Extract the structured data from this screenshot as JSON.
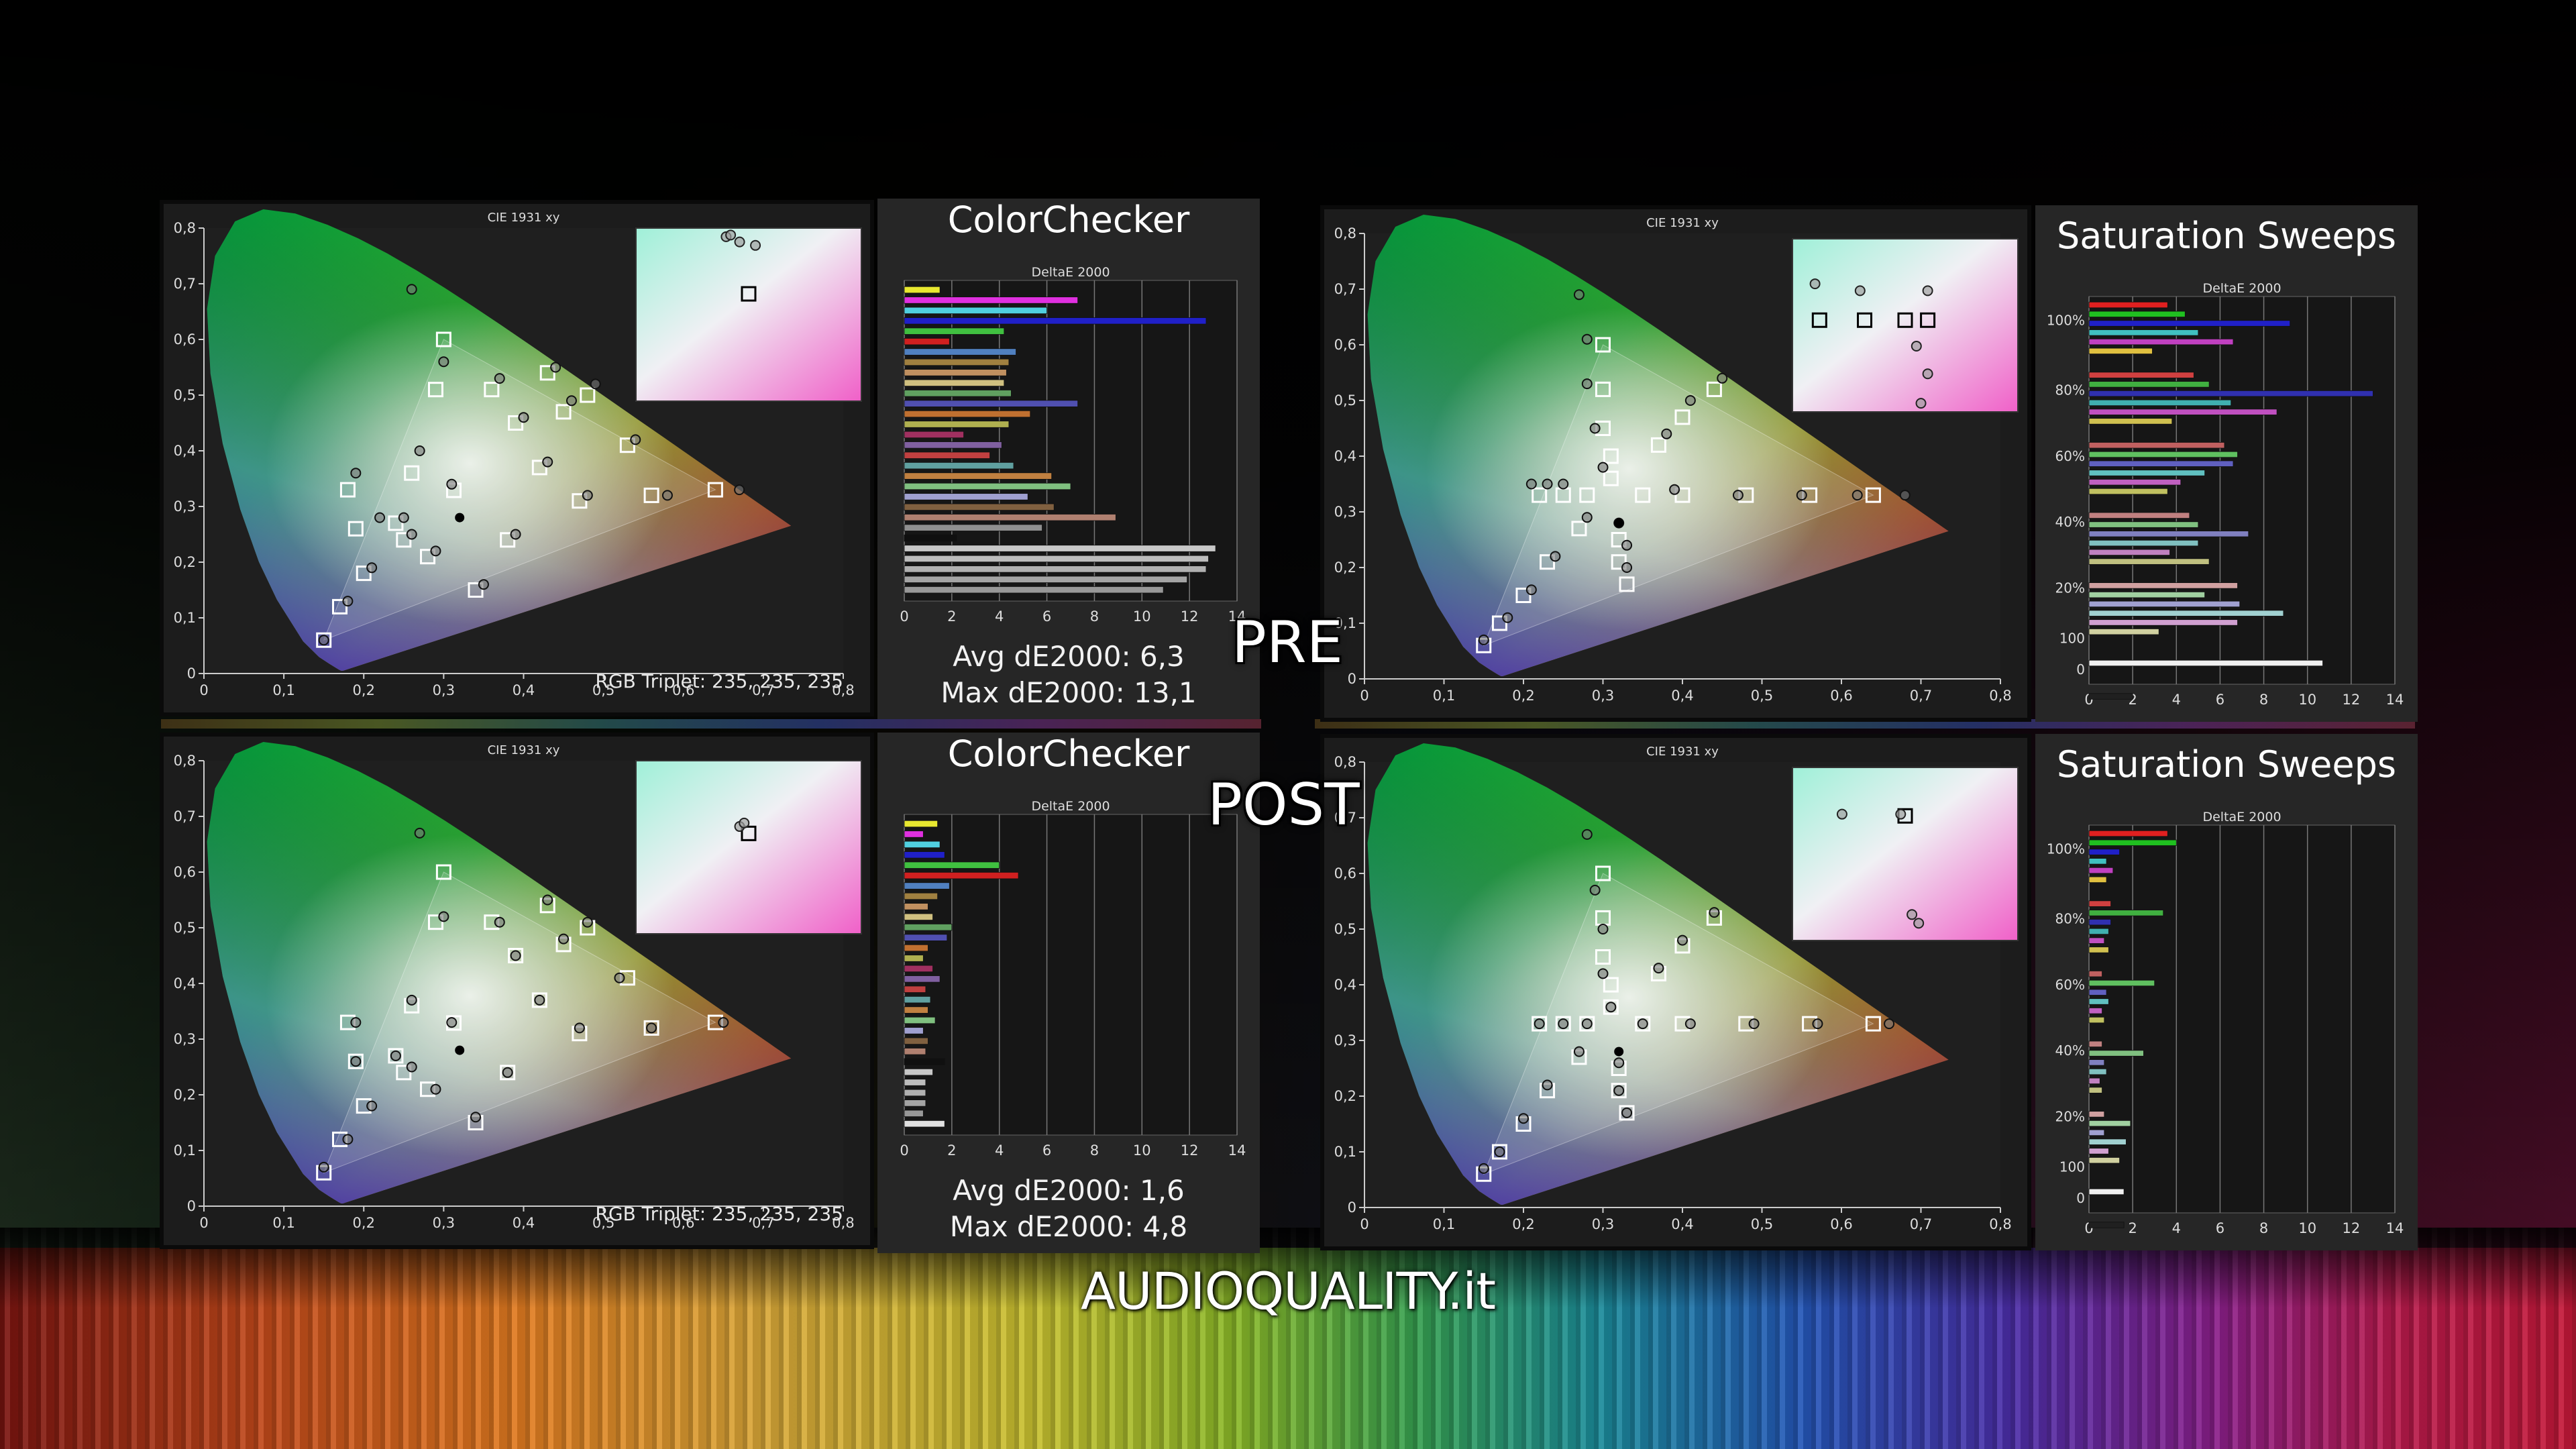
{
  "labels": {
    "pre": "PRE",
    "post": "POST",
    "brand": "AUDIOQUALITY.it"
  },
  "colors": {
    "accent_red": "#e02020",
    "primary_green": "#00c000",
    "primary_blue": "#2020ff"
  },
  "chart_data": [
    {
      "id": "pre-cie",
      "type": "scatter",
      "title": "CIE 1931 xy",
      "footnote": "RGB Triplet: 235, 235, 235",
      "xlim": [
        0,
        0.8
      ],
      "ylim": [
        0,
        0.8
      ],
      "x_ticks": [
        "0",
        "0,1",
        "0,2",
        "0,3",
        "0,4",
        "0,5",
        "0,6",
        "0,7",
        "0,8"
      ],
      "y_ticks": [
        "0",
        "0,1",
        "0,2",
        "0,3",
        "0,4",
        "0,5",
        "0,6",
        "0,7",
        "0,8"
      ],
      "targets": [
        [
          0.64,
          0.33
        ],
        [
          0.3,
          0.6
        ],
        [
          0.15,
          0.06
        ],
        [
          0.3127,
          0.329
        ],
        [
          0.18,
          0.33
        ],
        [
          0.19,
          0.26
        ],
        [
          0.2,
          0.18
        ],
        [
          0.17,
          0.12
        ],
        [
          0.24,
          0.27
        ],
        [
          0.25,
          0.24
        ],
        [
          0.28,
          0.21
        ],
        [
          0.34,
          0.15
        ],
        [
          0.38,
          0.24
        ],
        [
          0.47,
          0.31
        ],
        [
          0.56,
          0.32
        ],
        [
          0.42,
          0.37
        ],
        [
          0.39,
          0.45
        ],
        [
          0.45,
          0.47
        ],
        [
          0.43,
          0.54
        ],
        [
          0.53,
          0.41
        ],
        [
          0.48,
          0.5
        ],
        [
          0.36,
          0.51
        ],
        [
          0.29,
          0.51
        ],
        [
          0.26,
          0.36
        ]
      ],
      "measured": [
        [
          0.67,
          0.33
        ],
        [
          0.26,
          0.69
        ],
        [
          0.15,
          0.06
        ],
        [
          0.31,
          0.34
        ],
        [
          0.19,
          0.36
        ],
        [
          0.22,
          0.28
        ],
        [
          0.21,
          0.19
        ],
        [
          0.18,
          0.13
        ],
        [
          0.25,
          0.28
        ],
        [
          0.26,
          0.25
        ],
        [
          0.29,
          0.22
        ],
        [
          0.35,
          0.16
        ],
        [
          0.39,
          0.25
        ],
        [
          0.48,
          0.32
        ],
        [
          0.58,
          0.32
        ],
        [
          0.43,
          0.38
        ],
        [
          0.4,
          0.46
        ],
        [
          0.46,
          0.49
        ],
        [
          0.44,
          0.55
        ],
        [
          0.54,
          0.42
        ],
        [
          0.49,
          0.52
        ],
        [
          0.37,
          0.53
        ],
        [
          0.3,
          0.56
        ],
        [
          0.27,
          0.4
        ]
      ],
      "inset_targets": [
        [
          0.5,
          0.38
        ]
      ],
      "inset_measured": [
        [
          0.4,
          0.05
        ],
        [
          0.42,
          0.04
        ],
        [
          0.46,
          0.08
        ],
        [
          0.53,
          0.1
        ]
      ]
    },
    {
      "id": "pre-colorchecker",
      "type": "bar",
      "title": "ColorChecker",
      "subtitle": "DeltaE 2000",
      "xlim": [
        0,
        14
      ],
      "x_ticks": [
        "0",
        "2",
        "4",
        "6",
        "8",
        "10",
        "12",
        "14"
      ],
      "avg": "Avg dE2000: 6,3",
      "max": "Max dE2000: 13,1",
      "values": [
        1.5,
        7.3,
        6.0,
        12.7,
        4.2,
        1.9,
        4.7,
        4.4,
        4.3,
        4.2,
        4.5,
        7.3,
        5.3,
        4.4,
        2.5,
        4.1,
        3.6,
        4.6,
        6.2,
        7.0,
        5.2,
        6.3,
        8.9,
        5.8,
        2.2,
        13.1,
        12.8,
        12.7,
        11.9,
        10.9
      ],
      "bar_colors": [
        "#e8e830",
        "#e030e0",
        "#50d0e0",
        "#2020c8",
        "#40c040",
        "#d02020",
        "#5080c0",
        "#a08040",
        "#c09060",
        "#d0c080",
        "#60a060",
        "#5050b0",
        "#c07030",
        "#b0b050",
        "#a03060",
        "#8060a0",
        "#c04040",
        "#60a0a0",
        "#c08040",
        "#80c080",
        "#a0a0d0",
        "#806040",
        "#b08070",
        "#909090",
        "#101010",
        "#c8c8c8",
        "#bcbcbc",
        "#b0b0b0",
        "#a4a4a4",
        "#989898"
      ]
    },
    {
      "id": "pre-saturation-cie",
      "type": "scatter",
      "title": "CIE 1931 xy",
      "xlim": [
        0,
        0.8
      ],
      "ylim": [
        0,
        0.8
      ],
      "x_ticks": [
        "0",
        "0,1",
        "0,2",
        "0,3",
        "0,4",
        "0,5",
        "0,6",
        "0,7",
        "0,8"
      ],
      "y_ticks": [
        "0",
        "0,1",
        "0,2",
        "0,3",
        "0,4",
        "0,5",
        "0,6",
        "0,7",
        "0,8"
      ],
      "targets": [
        [
          0.64,
          0.33
        ],
        [
          0.56,
          0.33
        ],
        [
          0.48,
          0.33
        ],
        [
          0.4,
          0.33
        ],
        [
          0.35,
          0.33
        ],
        [
          0.3,
          0.6
        ],
        [
          0.3,
          0.52
        ],
        [
          0.3,
          0.45
        ],
        [
          0.31,
          0.4
        ],
        [
          0.31,
          0.36
        ],
        [
          0.15,
          0.06
        ],
        [
          0.17,
          0.1
        ],
        [
          0.2,
          0.15
        ],
        [
          0.23,
          0.21
        ],
        [
          0.27,
          0.27
        ],
        [
          0.22,
          0.33
        ],
        [
          0.25,
          0.33
        ],
        [
          0.28,
          0.33
        ],
        [
          0.44,
          0.52
        ],
        [
          0.4,
          0.47
        ],
        [
          0.37,
          0.42
        ],
        [
          0.33,
          0.17
        ],
        [
          0.32,
          0.21
        ],
        [
          0.32,
          0.25
        ]
      ],
      "measured": [
        [
          0.68,
          0.33
        ],
        [
          0.62,
          0.33
        ],
        [
          0.55,
          0.33
        ],
        [
          0.47,
          0.33
        ],
        [
          0.39,
          0.34
        ],
        [
          0.27,
          0.69
        ],
        [
          0.28,
          0.61
        ],
        [
          0.28,
          0.53
        ],
        [
          0.29,
          0.45
        ],
        [
          0.3,
          0.38
        ],
        [
          0.15,
          0.07
        ],
        [
          0.18,
          0.11
        ],
        [
          0.21,
          0.16
        ],
        [
          0.24,
          0.22
        ],
        [
          0.28,
          0.29
        ],
        [
          0.21,
          0.35
        ],
        [
          0.23,
          0.35
        ],
        [
          0.25,
          0.35
        ],
        [
          0.45,
          0.54
        ],
        [
          0.41,
          0.5
        ],
        [
          0.38,
          0.44
        ],
        [
          0.33,
          0.2
        ],
        [
          0.33,
          0.24
        ],
        [
          0.32,
          0.28
        ]
      ],
      "inset_targets": [
        [
          0.12,
          0.47
        ],
        [
          0.32,
          0.47
        ],
        [
          0.5,
          0.47
        ],
        [
          0.6,
          0.47
        ]
      ],
      "inset_measured": [
        [
          0.1,
          0.26
        ],
        [
          0.3,
          0.3
        ],
        [
          0.6,
          0.3
        ],
        [
          0.55,
          0.62
        ],
        [
          0.6,
          0.78
        ],
        [
          0.57,
          0.95
        ]
      ]
    },
    {
      "id": "pre-saturation-sweeps",
      "type": "bar",
      "title": "Saturation Sweeps",
      "subtitle": "DeltaE 2000",
      "xlim": [
        0,
        14
      ],
      "x_ticks": [
        "0",
        "2",
        "4",
        "6",
        "8",
        "10",
        "12",
        "14"
      ],
      "groups": [
        "100%",
        "80%",
        "60%",
        "40%",
        "20%",
        "100",
        "0"
      ],
      "values": [
        3.6,
        4.4,
        9.2,
        5.0,
        6.6,
        2.9,
        4.8,
        5.5,
        13.0,
        6.5,
        8.6,
        3.8,
        6.2,
        6.8,
        6.6,
        5.3,
        4.2,
        3.6,
        4.6,
        5.0,
        7.3,
        5.0,
        3.7,
        5.5,
        6.8,
        5.3,
        6.9,
        8.9,
        6.8,
        3.2,
        10.7,
        2.0
      ],
      "bar_colors": [
        "#e02020",
        "#20c020",
        "#2020c8",
        "#40c0c0",
        "#c040c0",
        "#e0c040",
        "#d04040",
        "#40b040",
        "#3030b0",
        "#40b0b0",
        "#c050c0",
        "#d0c050",
        "#c06060",
        "#60c060",
        "#6060c0",
        "#60c0c0",
        "#c060c0",
        "#c0c060",
        "#c08080",
        "#80c080",
        "#8080c0",
        "#80c0c0",
        "#c080c0",
        "#c0c080",
        "#d0a0a0",
        "#a0d0a0",
        "#a0a0d0",
        "#a0d0d0",
        "#d0a0d0",
        "#d0d0a0",
        "#f0f0f0",
        "#202020"
      ]
    },
    {
      "id": "post-cie",
      "type": "scatter",
      "title": "CIE 1931 xy",
      "footnote": "RGB Triplet: 235, 235, 235",
      "xlim": [
        0,
        0.8
      ],
      "ylim": [
        0,
        0.8
      ],
      "x_ticks": [
        "0",
        "0,1",
        "0,2",
        "0,3",
        "0,4",
        "0,5",
        "0,6",
        "0,7",
        "0,8"
      ],
      "y_ticks": [
        "0",
        "0,1",
        "0,2",
        "0,3",
        "0,4",
        "0,5",
        "0,6",
        "0,7",
        "0,8"
      ],
      "targets": [
        [
          0.64,
          0.33
        ],
        [
          0.3,
          0.6
        ],
        [
          0.15,
          0.06
        ],
        [
          0.3127,
          0.329
        ],
        [
          0.18,
          0.33
        ],
        [
          0.19,
          0.26
        ],
        [
          0.2,
          0.18
        ],
        [
          0.17,
          0.12
        ],
        [
          0.24,
          0.27
        ],
        [
          0.25,
          0.24
        ],
        [
          0.28,
          0.21
        ],
        [
          0.34,
          0.15
        ],
        [
          0.38,
          0.24
        ],
        [
          0.47,
          0.31
        ],
        [
          0.56,
          0.32
        ],
        [
          0.42,
          0.37
        ],
        [
          0.39,
          0.45
        ],
        [
          0.45,
          0.47
        ],
        [
          0.43,
          0.54
        ],
        [
          0.53,
          0.41
        ],
        [
          0.48,
          0.5
        ],
        [
          0.36,
          0.51
        ],
        [
          0.29,
          0.51
        ],
        [
          0.26,
          0.36
        ]
      ],
      "measured": [
        [
          0.65,
          0.33
        ],
        [
          0.27,
          0.67
        ],
        [
          0.15,
          0.07
        ],
        [
          0.31,
          0.33
        ],
        [
          0.19,
          0.33
        ],
        [
          0.19,
          0.26
        ],
        [
          0.21,
          0.18
        ],
        [
          0.18,
          0.12
        ],
        [
          0.24,
          0.27
        ],
        [
          0.26,
          0.25
        ],
        [
          0.29,
          0.21
        ],
        [
          0.34,
          0.16
        ],
        [
          0.38,
          0.24
        ],
        [
          0.47,
          0.32
        ],
        [
          0.56,
          0.32
        ],
        [
          0.42,
          0.37
        ],
        [
          0.39,
          0.45
        ],
        [
          0.45,
          0.48
        ],
        [
          0.43,
          0.55
        ],
        [
          0.52,
          0.41
        ],
        [
          0.48,
          0.51
        ],
        [
          0.37,
          0.51
        ],
        [
          0.3,
          0.52
        ],
        [
          0.26,
          0.37
        ]
      ],
      "inset_targets": [
        [
          0.5,
          0.42
        ]
      ],
      "inset_measured": [
        [
          0.46,
          0.38
        ],
        [
          0.48,
          0.36
        ]
      ]
    },
    {
      "id": "post-colorchecker",
      "type": "bar",
      "title": "ColorChecker",
      "subtitle": "DeltaE 2000",
      "xlim": [
        0,
        14
      ],
      "x_ticks": [
        "0",
        "2",
        "4",
        "6",
        "8",
        "10",
        "12",
        "14"
      ],
      "avg": "Avg dE2000: 1,6",
      "max": "Max dE2000: 4,8",
      "values": [
        1.4,
        0.8,
        1.5,
        1.7,
        4.0,
        4.8,
        1.9,
        1.4,
        1.0,
        1.2,
        2.0,
        1.8,
        1.0,
        0.8,
        1.2,
        1.5,
        0.9,
        1.1,
        1.0,
        1.3,
        0.8,
        1.0,
        0.9,
        1.7,
        1.2,
        0.9,
        0.9,
        0.9,
        0.8,
        1.7
      ],
      "bar_colors": [
        "#e8e830",
        "#e030e0",
        "#50d0e0",
        "#2020c8",
        "#40c040",
        "#d02020",
        "#5080c0",
        "#a08040",
        "#c09060",
        "#d0c080",
        "#60a060",
        "#5050b0",
        "#c07030",
        "#b0b050",
        "#a03060",
        "#8060a0",
        "#c04040",
        "#60a0a0",
        "#c08040",
        "#80c080",
        "#a0a0d0",
        "#806040",
        "#b08070",
        "#101010",
        "#c8c8c8",
        "#bcbcbc",
        "#b0b0b0",
        "#a4a4a4",
        "#989898",
        "#e0e0e0"
      ]
    },
    {
      "id": "post-saturation-cie",
      "type": "scatter",
      "title": "CIE 1931 xy",
      "xlim": [
        0,
        0.8
      ],
      "ylim": [
        0,
        0.8
      ],
      "x_ticks": [
        "0",
        "0,1",
        "0,2",
        "0,3",
        "0,4",
        "0,5",
        "0,6",
        "0,7",
        "0,8"
      ],
      "y_ticks": [
        "0",
        "0,1",
        "0,2",
        "0,3",
        "0,4",
        "0,5",
        "0,6",
        "0,7",
        "0,8"
      ],
      "targets": [
        [
          0.64,
          0.33
        ],
        [
          0.56,
          0.33
        ],
        [
          0.48,
          0.33
        ],
        [
          0.4,
          0.33
        ],
        [
          0.35,
          0.33
        ],
        [
          0.3,
          0.6
        ],
        [
          0.3,
          0.52
        ],
        [
          0.3,
          0.45
        ],
        [
          0.31,
          0.4
        ],
        [
          0.31,
          0.36
        ],
        [
          0.15,
          0.06
        ],
        [
          0.17,
          0.1
        ],
        [
          0.2,
          0.15
        ],
        [
          0.23,
          0.21
        ],
        [
          0.27,
          0.27
        ],
        [
          0.22,
          0.33
        ],
        [
          0.25,
          0.33
        ],
        [
          0.28,
          0.33
        ],
        [
          0.44,
          0.52
        ],
        [
          0.4,
          0.47
        ],
        [
          0.37,
          0.42
        ],
        [
          0.33,
          0.17
        ],
        [
          0.32,
          0.21
        ],
        [
          0.32,
          0.25
        ]
      ],
      "measured": [
        [
          0.66,
          0.33
        ],
        [
          0.57,
          0.33
        ],
        [
          0.49,
          0.33
        ],
        [
          0.41,
          0.33
        ],
        [
          0.35,
          0.33
        ],
        [
          0.28,
          0.67
        ],
        [
          0.29,
          0.57
        ],
        [
          0.3,
          0.5
        ],
        [
          0.3,
          0.42
        ],
        [
          0.31,
          0.36
        ],
        [
          0.15,
          0.07
        ],
        [
          0.17,
          0.1
        ],
        [
          0.2,
          0.16
        ],
        [
          0.23,
          0.22
        ],
        [
          0.27,
          0.28
        ],
        [
          0.22,
          0.33
        ],
        [
          0.25,
          0.33
        ],
        [
          0.28,
          0.33
        ],
        [
          0.44,
          0.53
        ],
        [
          0.4,
          0.48
        ],
        [
          0.37,
          0.43
        ],
        [
          0.33,
          0.17
        ],
        [
          0.32,
          0.21
        ],
        [
          0.32,
          0.26
        ]
      ],
      "inset_targets": [
        [
          0.5,
          0.28
        ]
      ],
      "inset_measured": [
        [
          0.22,
          0.27
        ],
        [
          0.48,
          0.27
        ],
        [
          0.53,
          0.85
        ],
        [
          0.56,
          0.9
        ]
      ]
    },
    {
      "id": "post-saturation-sweeps",
      "type": "bar",
      "title": "Saturation Sweeps",
      "subtitle": "DeltaE 2000",
      "xlim": [
        0,
        14
      ],
      "x_ticks": [
        "0",
        "2",
        "4",
        "6",
        "8",
        "10",
        "12",
        "14"
      ],
      "groups": [
        "100%",
        "80%",
        "60%",
        "40%",
        "20%",
        "100",
        "0"
      ],
      "values": [
        3.6,
        4.0,
        1.4,
        0.8,
        1.1,
        0.8,
        1.0,
        3.4,
        1.0,
        0.9,
        0.7,
        0.9,
        0.6,
        3.0,
        0.8,
        0.9,
        0.6,
        0.7,
        0.6,
        2.5,
        0.7,
        0.8,
        0.5,
        0.6,
        0.7,
        1.9,
        0.7,
        1.7,
        0.9,
        1.4,
        1.6,
        1.6
      ],
      "bar_colors": [
        "#e02020",
        "#20c020",
        "#2020c8",
        "#40c0c0",
        "#c040c0",
        "#e0c040",
        "#d04040",
        "#40b040",
        "#3030b0",
        "#40b0b0",
        "#c050c0",
        "#d0c050",
        "#c06060",
        "#60c060",
        "#6060c0",
        "#60c0c0",
        "#c060c0",
        "#c0c060",
        "#c08080",
        "#80c080",
        "#8080c0",
        "#80c0c0",
        "#c080c0",
        "#c0c080",
        "#d0a0a0",
        "#a0d0a0",
        "#a0a0d0",
        "#a0d0d0",
        "#d0a0d0",
        "#d0d0a0",
        "#f0f0f0",
        "#202020"
      ]
    }
  ]
}
